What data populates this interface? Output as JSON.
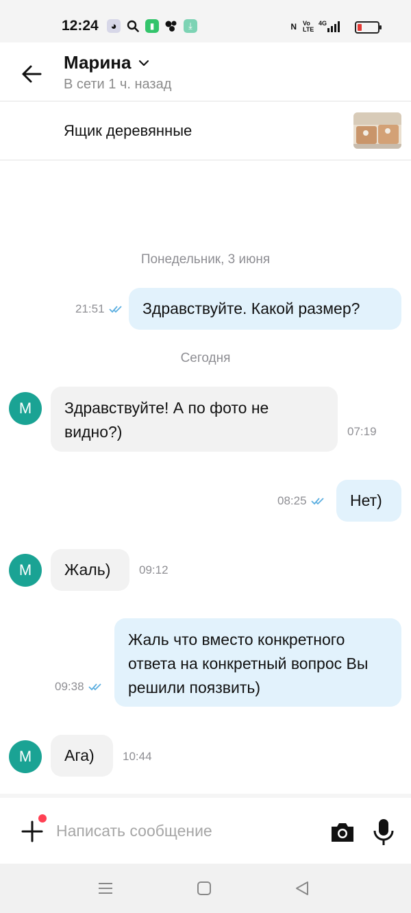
{
  "status_bar": {
    "time": "12:24",
    "icons_left": [
      "app-icon",
      "search-icon",
      "battery-saver-icon",
      "bubbles-icon",
      "download-icon"
    ],
    "icons_right": [
      "nfc-icon",
      "volte-icon",
      "signal-4g-icon",
      "battery-low-icon"
    ],
    "nfc_label": "N",
    "volte_label": "Vo LTE",
    "net_label": "4G"
  },
  "header": {
    "contact_name": "Марина",
    "contact_status": "В сети 1 ч. назад"
  },
  "listing": {
    "title": "Ящик деревянные"
  },
  "chat": {
    "date_1": "Понедельник, 3 июня",
    "date_2": "Сегодня",
    "avatar_letter": "М",
    "messages": [
      {
        "direction": "out",
        "text": "Здравствуйте. Какой размер?",
        "time": "21:51",
        "read": true
      },
      {
        "direction": "in",
        "text": "Здравствуйте! А по фото не видно?)",
        "time": "07:19"
      },
      {
        "direction": "out",
        "text": "Нет)",
        "time": "08:25",
        "read": true
      },
      {
        "direction": "in",
        "text": "Жаль)",
        "time": "09:12"
      },
      {
        "direction": "out",
        "text": "Жаль что вместо конкретного ответа на конкретный вопрос Вы решили поязвить)",
        "time": "09:38",
        "read": true
      },
      {
        "direction": "in",
        "text": "Ага)",
        "time": "10:44"
      }
    ]
  },
  "composer": {
    "placeholder": "Написать сообщение",
    "value": ""
  },
  "colors": {
    "outgoing_bubble": "#e2f2fc",
    "incoming_bubble": "#f2f2f2",
    "avatar": "#1aa394",
    "read_ticks": "#5aaee0",
    "notification_dot": "#ff4053"
  }
}
